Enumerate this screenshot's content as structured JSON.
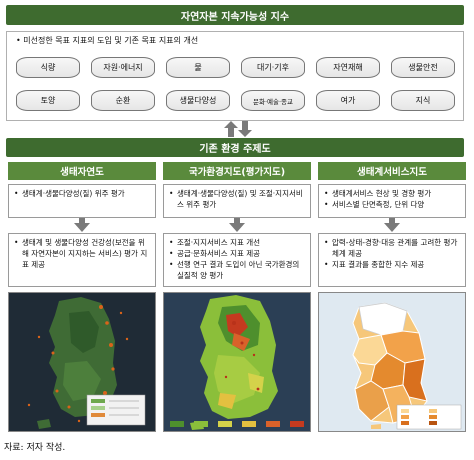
{
  "title": "자연자본 지속가능성 지수",
  "top_bullet": "미선정한 목표 지표의 도입 및 기존 목표 지표의 개선",
  "indicator_row1": [
    "식량",
    "자원·에너지",
    "물",
    "대기·기후",
    "자연재해",
    "생물안전"
  ],
  "indicator_row2": [
    "토양",
    "순환",
    "생물다양성",
    "문화·예술·종교",
    "여가",
    "지식"
  ],
  "middle_header": "기존 환경 주제도",
  "columns": [
    {
      "header": "생태자연도",
      "upper_bullets": [
        "생태계·생물다양성(질) 위주 평가"
      ],
      "lower_bullets": [
        "생태계 및 생물다양성 건강성(보전을 위해 자연자본이 지지하는 서비스) 평가 지표 제공"
      ]
    },
    {
      "header": "국가환경지도(평가지도)",
      "upper_bullets": [
        "생태계·생물다양성(질) 및 조절·지지서비스 위주 평가"
      ],
      "lower_bullets": [
        "조절·지지서비스 지표 개선",
        "공급·문화서비스 지표 제공",
        "선행 연구 결과 도입이 아닌 국가환경의 실질적 양 평가"
      ]
    },
    {
      "header": "생태계서비스지도",
      "upper_bullets": [
        "생태계서비스 현상 및 경향 평가",
        "서비스별 단면측정, 단위 다양"
      ],
      "lower_bullets": [
        "압력-상태-경향·대응 관계를 고려한 평가체계 제공",
        "지표 결과를 종합한 지수 제공"
      ]
    }
  ],
  "caption": "자료: 저자 작성.",
  "colors": {
    "header_dark": "#3e6b2f",
    "header_col": "#5a8a3c",
    "arrow": "#7a7a7a"
  }
}
